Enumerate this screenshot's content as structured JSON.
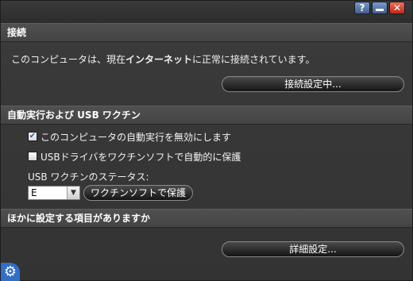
{
  "titlebar": {
    "help_label": "?",
    "close_label": "✕"
  },
  "connection": {
    "header": "接続",
    "status_prefix": "このコンピュータは、現在",
    "status_bold": "インターネット",
    "status_suffix": "に正常に接続されています。",
    "settings_button": "接続設定中..."
  },
  "autorun": {
    "header": "自動実行および USB ワクチン",
    "checkbox_disable_autorun": {
      "label": "このコンピュータの自動実行を無効にします",
      "checked": true
    },
    "checkbox_usb_protect": {
      "label": "USBドライバをワクチンソフトで自動的に保護",
      "checked": false
    },
    "status_label": "USB ワクチンのステータス:",
    "drive_select_value": "E",
    "protect_button": "ワクチンソフトで保護"
  },
  "other": {
    "header": "ほかに設定する項目がありますか",
    "details_button": "詳細設定..."
  },
  "icons": {
    "help": "help-icon",
    "minimize": "minimize-icon",
    "close": "close-icon",
    "gear": "gear-icon",
    "check": "checkmark-icon",
    "dropdown": "chevron-down-icon"
  },
  "colors": {
    "background": "#3a3a3a",
    "header_bg": "#4a4a4a",
    "title_button_blue": "#4e6fa6",
    "close_red": "#d83a2a",
    "gear_blue": "#2f6fc8"
  }
}
